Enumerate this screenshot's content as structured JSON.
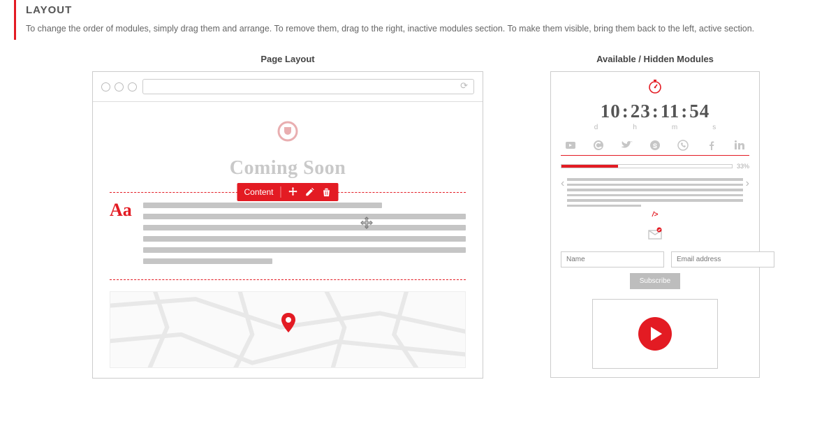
{
  "header": {
    "title": "LAYOUT",
    "description": "To change the order of modules, simply drag them and arrange. To remove them, drag to the right, inactive modules section. To make them visible, bring them back to the left, active section."
  },
  "left": {
    "title": "Page Layout",
    "coming_soon": "Coming Soon",
    "tooltip_label": "Content",
    "aa": "Aa"
  },
  "right": {
    "title": "Available / Hidden Modules",
    "countdown": {
      "d": "10",
      "h": "23",
      "m": "11",
      "s": "54",
      "labels": {
        "d": "d",
        "h": "h",
        "m": "m",
        "s": "s"
      }
    },
    "progress_pct": "33%",
    "closepath": "/>",
    "form": {
      "name_ph": "Name",
      "email_ph": "Email address",
      "submit": "Subscribe"
    }
  }
}
